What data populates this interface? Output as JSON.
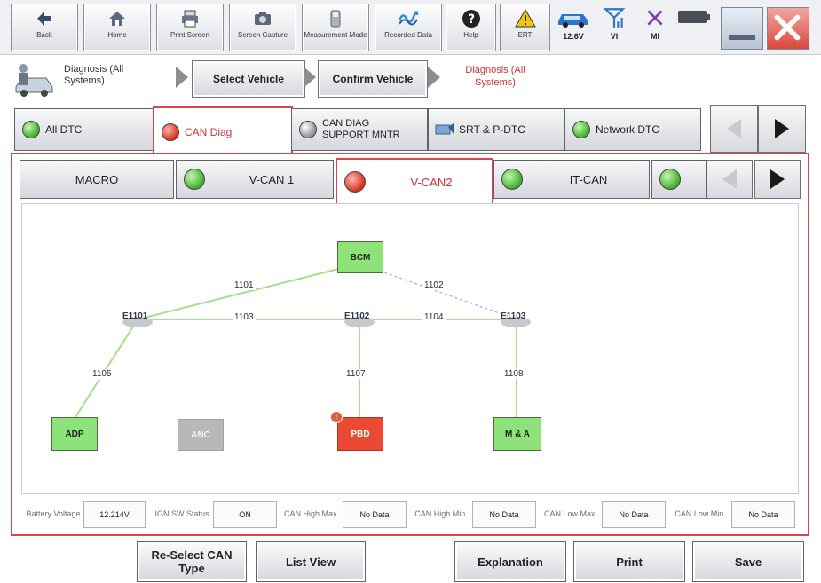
{
  "toolbar": {
    "back": "Back",
    "home": "Home",
    "print_screen": "Print Screen",
    "screen_capture": "Screen Capture",
    "measurement_mode": "Measurement Mode",
    "recorded_data": "Recorded Data",
    "help": "Help",
    "ert": "ERT",
    "battery": "12.6V",
    "vi": "VI",
    "mi": "MI"
  },
  "breadcrumb": {
    "context": "Diagnosis (All Systems)",
    "select_vehicle": "Select Vehicle",
    "confirm_vehicle": "Confirm Vehicle",
    "current": "Diagnosis (All Systems)"
  },
  "tabs": [
    {
      "label": "All DTC",
      "status": "green"
    },
    {
      "label": "CAN Diag",
      "status": "red"
    },
    {
      "label": "CAN DIAG SUPPORT MNTR",
      "status": "grey"
    },
    {
      "label": "SRT & P-DTC",
      "status": "none"
    },
    {
      "label": "Network DTC",
      "status": "green"
    }
  ],
  "subtabs": [
    {
      "label": "MACRO"
    },
    {
      "label": "V-CAN 1",
      "status": "green"
    },
    {
      "label": "V-CAN2",
      "status": "red"
    },
    {
      "label": "IT-CAN",
      "status": "green"
    },
    {
      "label": "",
      "status": "green"
    }
  ],
  "diagram": {
    "nodes": {
      "bcm": "BCM",
      "adp": "ADP",
      "anc": "ANC",
      "pbd": "PBD",
      "ma": "M & A"
    },
    "junctions": {
      "e1101": "E1101",
      "e1102": "E1102",
      "e1103": "E1103"
    },
    "links": {
      "l1101": "1101",
      "l1102": "1102",
      "l1103": "1103",
      "l1104": "1104",
      "l1105": "1105",
      "l1107": "1107",
      "l1108": "1108"
    },
    "colors": {
      "ok_line": "#9fe28c",
      "dashed_line": "#b9bbbe",
      "ok_node": "#8ee27a",
      "error_node": "#ea4a34"
    }
  },
  "status": {
    "battery_voltage_label": "Battery Voltage",
    "battery_voltage": "12.214V",
    "ign_label": "IGN SW Status",
    "ign": "ON",
    "can_high_max_label": "CAN High Max.",
    "can_high_max": "No Data",
    "can_high_min_label": "CAN High Min.",
    "can_high_min": "No Data",
    "can_low_max_label": "CAN Low Max.",
    "can_low_max": "No Data",
    "can_low_min_label": "CAN Low Min.",
    "can_low_min": "No Data"
  },
  "buttons": {
    "reselect": "Re-Select CAN Type",
    "list_view": "List View",
    "explanation": "Explanation",
    "print": "Print",
    "save": "Save"
  }
}
